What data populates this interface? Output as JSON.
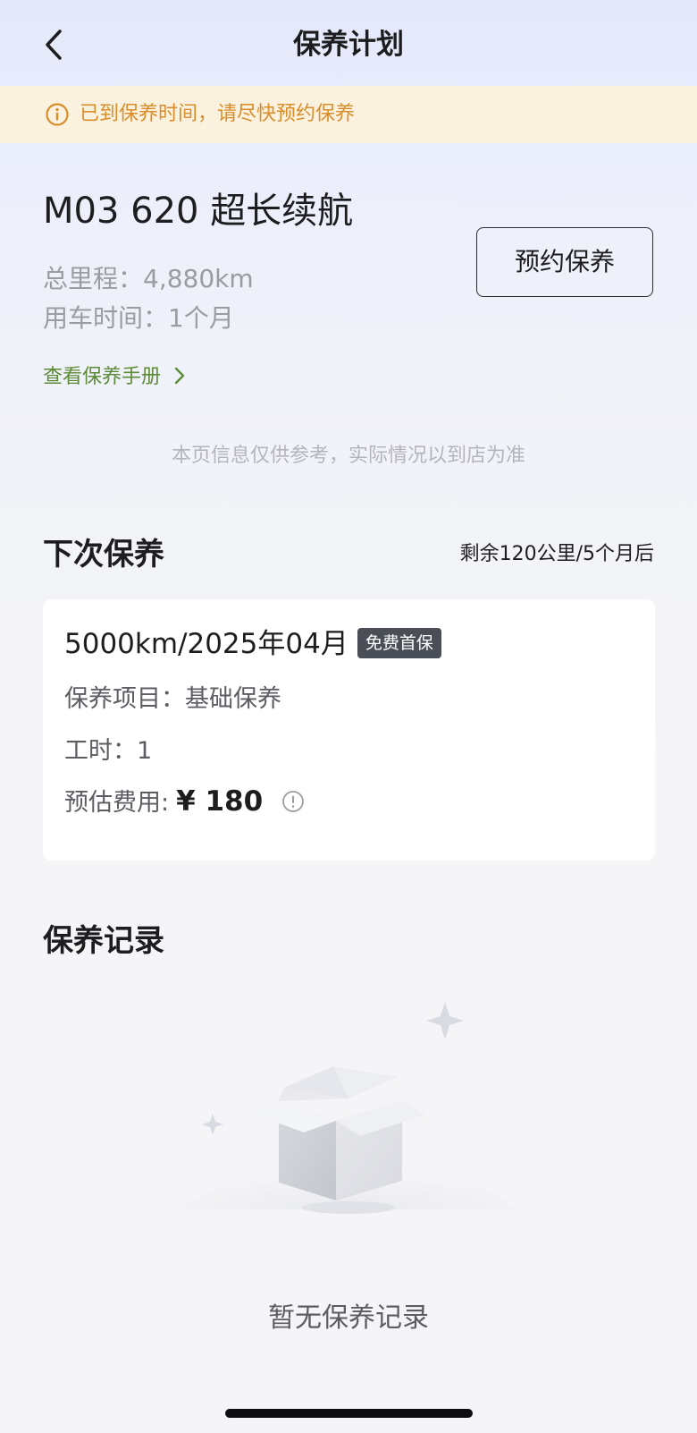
{
  "nav": {
    "title": "保养计划"
  },
  "notice": {
    "text": "已到保养时间，请尽快预约保养",
    "color": "#d98d2b"
  },
  "vehicle": {
    "model": "M03 620 超长续航",
    "mileage": "总里程：4,880km",
    "usage_time": "用车时间：1个月",
    "book_button": "预约保养",
    "manual_link": "查看保养手册"
  },
  "disclaimer": "本页信息仅供参考，实际情况以到店为准",
  "next_maintenance": {
    "section_title": "下次保养",
    "remaining": "剩余120公里/5个月后",
    "plan": "5000km/2025年04月",
    "badge": "免费首保",
    "items": "保养项目：基础保养",
    "labor_hours": "工时：1",
    "cost_label": "预估费用:",
    "cost_value": "¥ 180"
  },
  "records": {
    "section_title": "保养记录",
    "empty_text": "暂无保养记录"
  },
  "icons": {
    "back": "chevron-left-icon",
    "notice": "info-circle-icon",
    "manual": "chevron-right-icon",
    "cost_info": "exclamation-circle-icon",
    "empty": "empty-box-icon"
  },
  "colors": {
    "accent_green": "#5d8a38",
    "notice_background": "#fbf1df",
    "badge_background": "#4a4e57"
  }
}
